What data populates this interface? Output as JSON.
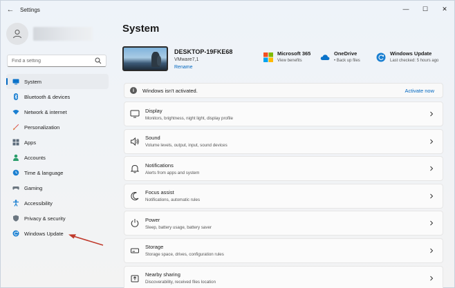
{
  "window": {
    "title": "Settings",
    "back_glyph": "←",
    "controls": [
      "—",
      "☐",
      "✕"
    ]
  },
  "sidebar": {
    "search_placeholder": "Find a setting",
    "items": [
      {
        "label": "System",
        "icon": "monitor-icon",
        "active": true
      },
      {
        "label": "Bluetooth & devices",
        "icon": "bluetooth-icon"
      },
      {
        "label": "Network & internet",
        "icon": "wifi-icon"
      },
      {
        "label": "Personalization",
        "icon": "brush-icon"
      },
      {
        "label": "Apps",
        "icon": "apps-icon"
      },
      {
        "label": "Accounts",
        "icon": "person-icon"
      },
      {
        "label": "Time & language",
        "icon": "globe-clock-icon"
      },
      {
        "label": "Gaming",
        "icon": "gamepad-icon"
      },
      {
        "label": "Accessibility",
        "icon": "accessibility-icon"
      },
      {
        "label": "Privacy & security",
        "icon": "shield-icon"
      },
      {
        "label": "Windows Update",
        "icon": "refresh-icon"
      }
    ]
  },
  "main": {
    "title": "System",
    "device": {
      "name": "DESKTOP-19FKE68",
      "model": "VMware7,1",
      "rename": "Rename"
    },
    "quick_links": [
      {
        "title": "Microsoft 365",
        "sub": "View benefits",
        "icon": "microsoft-logo-icon"
      },
      {
        "title": "OneDrive",
        "sub": "• Back up files",
        "icon": "cloud-icon"
      },
      {
        "title": "Windows Update",
        "sub": "Last checked: 5 hours ago",
        "icon": "refresh-icon"
      }
    ],
    "activation": {
      "text": "Windows isn't activated.",
      "link": "Activate now"
    },
    "cards": [
      {
        "title": "Display",
        "sub": "Monitors, brightness, night light, display profile",
        "icon": "display-icon"
      },
      {
        "title": "Sound",
        "sub": "Volume levels, output, input, sound devices",
        "icon": "speaker-icon"
      },
      {
        "title": "Notifications",
        "sub": "Alerts from apps and system",
        "icon": "bell-icon"
      },
      {
        "title": "Focus assist",
        "sub": "Notifications, automatic rules",
        "icon": "moon-icon"
      },
      {
        "title": "Power",
        "sub": "Sleep, battery usage, battery saver",
        "icon": "power-icon"
      },
      {
        "title": "Storage",
        "sub": "Storage space, drives, configuration rules",
        "icon": "storage-icon"
      },
      {
        "title": "Nearby sharing",
        "sub": "Discoverability, received files location",
        "icon": "share-icon"
      }
    ]
  },
  "colors": {
    "accent": "#0067c0",
    "annotation": "#c0392b"
  }
}
